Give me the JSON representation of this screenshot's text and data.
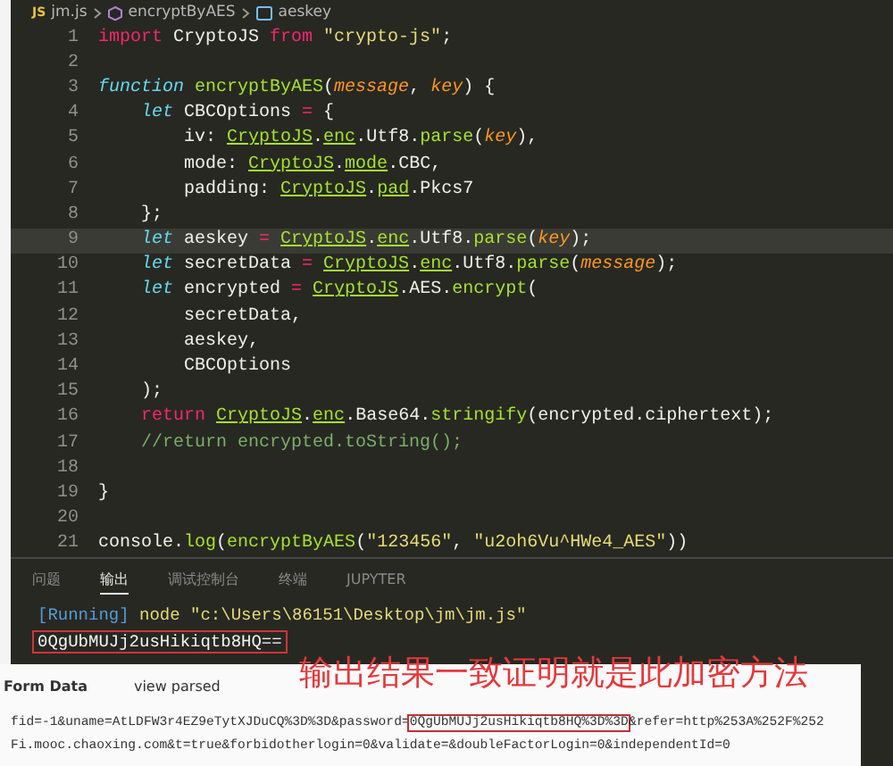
{
  "breadcrumb": {
    "file_icon_text": "JS",
    "items": [
      {
        "text": "jm.js",
        "kind": "file"
      },
      {
        "text": "encryptByAES",
        "kind": "function"
      },
      {
        "text": "aeskey",
        "kind": "variable"
      }
    ]
  },
  "code": {
    "lines": [
      {
        "number": "1",
        "highlighted": false,
        "tokens": [
          {
            "text": "import",
            "kind": "keyword"
          },
          {
            "text": " CryptoJS ",
            "kind": "plain"
          },
          {
            "text": "from ",
            "kind": "keyword"
          },
          {
            "text": "\"crypto-js\"",
            "kind": "string"
          },
          {
            "text": ";",
            "kind": "plain"
          }
        ]
      },
      {
        "number": "2",
        "highlighted": false
      },
      {
        "number": "3",
        "highlighted": false,
        "tokens": [
          {
            "text": "function ",
            "kind": "storage"
          },
          {
            "text": "encryptByAES",
            "kind": "function"
          },
          {
            "text": "(",
            "kind": "plain"
          },
          {
            "text": "message",
            "kind": "param"
          },
          {
            "text": ", ",
            "kind": "plain"
          },
          {
            "text": "key",
            "kind": "param"
          },
          {
            "text": ") {",
            "kind": "plain"
          }
        ]
      },
      {
        "number": "4",
        "highlighted": false,
        "tokens": [
          {
            "text": "    let",
            "kind": "storage"
          },
          {
            "text": " CBCOptions ",
            "kind": "plain"
          },
          {
            "text": "=",
            "kind": "operator"
          },
          {
            "text": " {",
            "kind": "plain"
          }
        ]
      },
      {
        "number": "5",
        "highlighted": false,
        "tokens": [
          {
            "text": "        iv: ",
            "kind": "plain"
          },
          {
            "text": "CryptoJS",
            "kind": "namespace"
          },
          {
            "text": ".",
            "kind": "plain"
          },
          {
            "text": "enc",
            "kind": "namespace"
          },
          {
            "text": ".Utf8.",
            "kind": "plain"
          },
          {
            "text": "parse",
            "kind": "function"
          },
          {
            "text": "(",
            "kind": "plain"
          },
          {
            "text": "key",
            "kind": "param"
          },
          {
            "text": "),",
            "kind": "plain"
          }
        ]
      },
      {
        "number": "6",
        "highlighted": false,
        "tokens": [
          {
            "text": "        mode: ",
            "kind": "plain"
          },
          {
            "text": "CryptoJS",
            "kind": "namespace"
          },
          {
            "text": ".",
            "kind": "plain"
          },
          {
            "text": "mode",
            "kind": "namespace"
          },
          {
            "text": ".CBC,",
            "kind": "plain"
          }
        ]
      },
      {
        "number": "7",
        "highlighted": false,
        "tokens": [
          {
            "text": "        padding: ",
            "kind": "plain"
          },
          {
            "text": "CryptoJS",
            "kind": "namespace"
          },
          {
            "text": ".",
            "kind": "plain"
          },
          {
            "text": "pad",
            "kind": "namespace"
          },
          {
            "text": ".Pkcs7",
            "kind": "plain"
          }
        ]
      },
      {
        "number": "8",
        "highlighted": false,
        "tokens": [
          {
            "text": "    };",
            "kind": "plain"
          }
        ]
      },
      {
        "number": "9",
        "highlighted": true,
        "tokens": [
          {
            "text": "    let",
            "kind": "storage"
          },
          {
            "text": " aeskey ",
            "kind": "plain"
          },
          {
            "text": "= ",
            "kind": "operator"
          },
          {
            "text": "CryptoJS",
            "kind": "namespace"
          },
          {
            "text": ".",
            "kind": "plain"
          },
          {
            "text": "enc",
            "kind": "namespace"
          },
          {
            "text": ".Utf8.",
            "kind": "plain"
          },
          {
            "text": "parse",
            "kind": "function"
          },
          {
            "text": "(",
            "kind": "plain"
          },
          {
            "text": "key",
            "kind": "param"
          },
          {
            "text": ");",
            "kind": "plain"
          }
        ]
      },
      {
        "number": "10",
        "highlighted": false,
        "tokens": [
          {
            "text": "    let",
            "kind": "storage"
          },
          {
            "text": " secretData ",
            "kind": "plain"
          },
          {
            "text": "= ",
            "kind": "operator"
          },
          {
            "text": "CryptoJS",
            "kind": "namespace"
          },
          {
            "text": ".",
            "kind": "plain"
          },
          {
            "text": "enc",
            "kind": "namespace"
          },
          {
            "text": ".Utf8.",
            "kind": "plain"
          },
          {
            "text": "parse",
            "kind": "function"
          },
          {
            "text": "(",
            "kind": "plain"
          },
          {
            "text": "message",
            "kind": "param"
          },
          {
            "text": ");",
            "kind": "plain"
          }
        ]
      },
      {
        "number": "11",
        "highlighted": false,
        "tokens": [
          {
            "text": "    let",
            "kind": "storage"
          },
          {
            "text": " encrypted ",
            "kind": "plain"
          },
          {
            "text": "= ",
            "kind": "operator"
          },
          {
            "text": "CryptoJS",
            "kind": "namespace"
          },
          {
            "text": ".AES.",
            "kind": "plain"
          },
          {
            "text": "encrypt",
            "kind": "function"
          },
          {
            "text": "(",
            "kind": "plain"
          }
        ]
      },
      {
        "number": "12",
        "highlighted": false,
        "tokens": [
          {
            "text": "        secretData,",
            "kind": "plain"
          }
        ]
      },
      {
        "number": "13",
        "highlighted": false,
        "tokens": [
          {
            "text": "        aeskey,",
            "kind": "plain"
          }
        ]
      },
      {
        "number": "14",
        "highlighted": false,
        "tokens": [
          {
            "text": "        CBCOptions",
            "kind": "plain"
          }
        ]
      },
      {
        "number": "15",
        "highlighted": false,
        "tokens": [
          {
            "text": "    );",
            "kind": "plain"
          }
        ]
      },
      {
        "number": "16",
        "highlighted": false,
        "tokens": [
          {
            "text": "    return ",
            "kind": "keyword"
          },
          {
            "text": "CryptoJS",
            "kind": "namespace"
          },
          {
            "text": ".",
            "kind": "plain"
          },
          {
            "text": "enc",
            "kind": "namespace"
          },
          {
            "text": ".Base64.",
            "kind": "plain"
          },
          {
            "text": "stringify",
            "kind": "function"
          },
          {
            "text": "(encrypted.ciphertext);",
            "kind": "plain"
          }
        ]
      },
      {
        "number": "17",
        "highlighted": false,
        "tokens": [
          {
            "text": "    //return encrypted.toString();",
            "kind": "comment"
          }
        ]
      },
      {
        "number": "18",
        "highlighted": false
      },
      {
        "number": "19",
        "highlighted": false,
        "tokens": [
          {
            "text": "}",
            "kind": "plain"
          }
        ]
      },
      {
        "number": "20",
        "highlighted": false
      },
      {
        "number": "21",
        "highlighted": false,
        "tokens": [
          {
            "text": "console.",
            "kind": "plain"
          },
          {
            "text": "log",
            "kind": "function"
          },
          {
            "text": "(",
            "kind": "plain"
          },
          {
            "text": "encryptByAES",
            "kind": "function"
          },
          {
            "text": "(",
            "kind": "plain"
          },
          {
            "text": "\"123456\"",
            "kind": "string"
          },
          {
            "text": ", ",
            "kind": "plain"
          },
          {
            "text": "\"u2oh6Vu^HWe4_AES\"",
            "kind": "string"
          },
          {
            "text": "))",
            "kind": "plain"
          }
        ]
      }
    ]
  },
  "panel": {
    "tabs": [
      {
        "label": "问题",
        "selected": false
      },
      {
        "label": "输出",
        "selected": true
      },
      {
        "label": "调试控制台",
        "selected": false
      },
      {
        "label": "终端",
        "selected": false
      },
      {
        "label": "JUPYTER",
        "selected": false
      }
    ],
    "output": [
      {
        "highlighted": false,
        "parts": [
          {
            "text": "[Running]",
            "kind": "tag"
          },
          {
            "text": " node \"c:\\Users\\86151\\Desktop\\jm\\jm.js\"",
            "kind": "command"
          }
        ]
      },
      {
        "highlighted": true,
        "parts": [
          {
            "text": "0QgUbMUJj2usHikiqtb8HQ==",
            "kind": "result"
          }
        ]
      }
    ]
  },
  "devtools": {
    "tabs": [
      {
        "label": "Form Data",
        "selected": true
      },
      {
        "label": "view parsed",
        "selected": false
      }
    ],
    "annotation": "输出结果一致证明就是此加密方法",
    "form_data": [
      {
        "segments": [
          {
            "text": "fid=-1&uname=AtLDFW3r4EZ9eTytXJDuCQ%3D%3D&password=",
            "highlighted": false
          },
          {
            "text": "0QgUbMUJj2usHikiqtb8HQ%3D%3D",
            "highlighted": true
          },
          {
            "text": "&refer=http%253A%252F%252",
            "highlighted": false
          }
        ]
      },
      {
        "segments": [
          {
            "text": "Fi.mooc.chaoxing.com&t=true&forbidotherlogin=0&validate=&doubleFactorLogin=0&independentId=0",
            "highlighted": false
          }
        ]
      }
    ]
  }
}
